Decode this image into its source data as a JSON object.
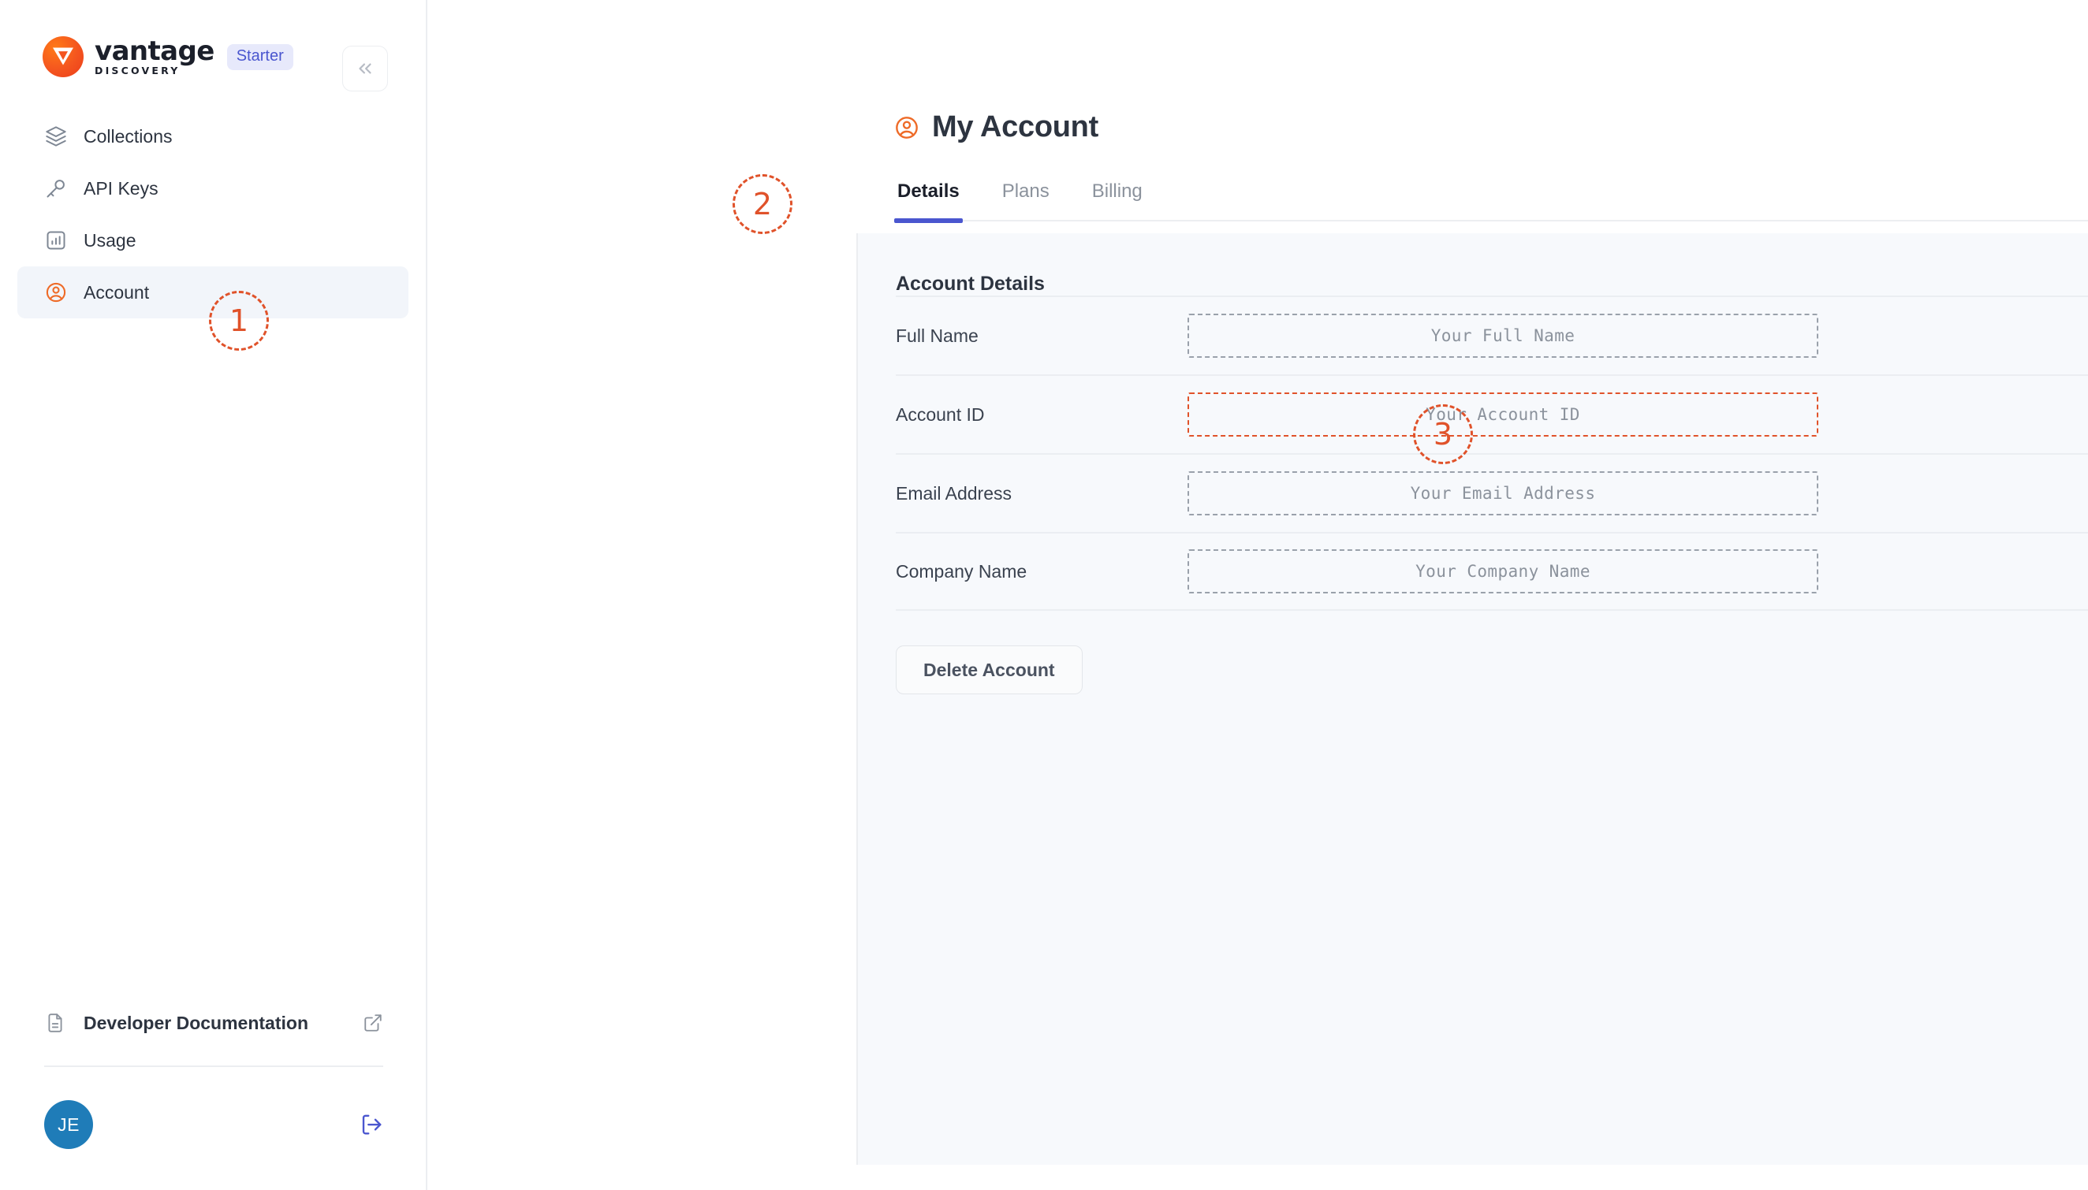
{
  "brand": {
    "name": "vantage",
    "subtitle": "DISCOVERY",
    "plan_badge": "Starter",
    "collapse_icon": "chevron-double-left-icon"
  },
  "sidebar": {
    "items": [
      {
        "label": "Collections",
        "icon": "layers-icon",
        "active": false
      },
      {
        "label": "API Keys",
        "icon": "key-icon",
        "active": false
      },
      {
        "label": "Usage",
        "icon": "bar-chart-icon",
        "active": false
      },
      {
        "label": "Account",
        "icon": "user-circle-icon",
        "active": true
      }
    ],
    "footer": {
      "doc_label": "Developer Documentation",
      "doc_icon": "document-icon",
      "external_icon": "external-link-icon",
      "avatar_initials": "JE",
      "avatar_color": "#1f7cb8",
      "logout_icon": "logout-icon"
    }
  },
  "header": {
    "title": "My Account",
    "icon": "user-circle-icon"
  },
  "tabs": [
    {
      "label": "Details",
      "active": true
    },
    {
      "label": "Plans",
      "active": false
    },
    {
      "label": "Billing",
      "active": false
    }
  ],
  "account_details": {
    "section_title": "Account Details",
    "fields": [
      {
        "label": "Full Name",
        "placeholder": "Your Full Name",
        "highlighted": false
      },
      {
        "label": "Account ID",
        "placeholder": "Your Account ID",
        "highlighted": true
      },
      {
        "label": "Email Address",
        "placeholder": "Your Email Address",
        "highlighted": false
      },
      {
        "label": "Company Name",
        "placeholder": "Your Company Name",
        "highlighted": false
      }
    ],
    "edit_icon": "edit-square-icon",
    "delete_button": "Delete Account"
  },
  "annotations": [
    {
      "number": "1",
      "target": "sidebar-item-account"
    },
    {
      "number": "2",
      "target": "tab-billing"
    },
    {
      "number": "3",
      "target": "account-id-field"
    }
  ],
  "colors": {
    "accent_orange": "#ee6b28",
    "accent_indigo": "#4a56cf",
    "annotation": "#e0522a",
    "panel_bg": "#f7f9fc"
  }
}
